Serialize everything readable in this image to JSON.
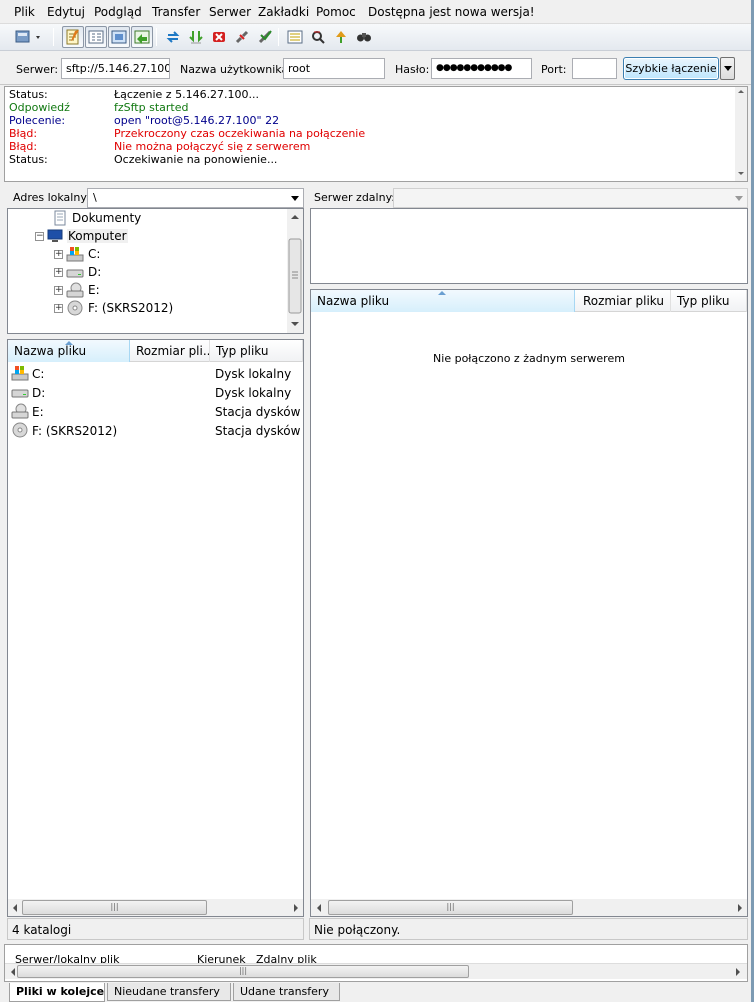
{
  "menu": [
    "Plik",
    "Edytuj",
    "Podgląd",
    "Transfer",
    "Serwer",
    "Zakładki",
    "Pomoc",
    "Dostępna jest nowa wersja!"
  ],
  "toolbar": {
    "buttons": [
      "site-manager-icon",
      "log-toggle-icon",
      "directory-tree-icon",
      "remote-tree-icon",
      "queue-toggle-icon",
      "refresh-icon",
      "process-queue-icon",
      "cancel-icon",
      "disconnect-icon",
      "reconnect-icon",
      "filter-icon",
      "compare-icon",
      "sync-browse-icon",
      "search-icon"
    ]
  },
  "quickconnect": {
    "server_label": "Serwer:",
    "server_value": "sftp://5.146.27.100",
    "user_label": "Nazwa użytkownika:",
    "user_value": "root",
    "password_label": "Hasło:",
    "password_value": "●●●●●●●●●●●",
    "port_label": "Port:",
    "port_value": "",
    "connect_label": "Szybkie łączenie"
  },
  "log": [
    {
      "type": "Status:",
      "msg": "Łączenie z 5.146.27.100...",
      "color": "black"
    },
    {
      "type": "Odpowiedź",
      "msg": "fzSftp started",
      "color": "green"
    },
    {
      "type": "Polecenie:",
      "msg": "open \"root@5.146.27.100\" 22",
      "color": "blue"
    },
    {
      "type": "Błąd:",
      "msg": "Przekroczony czas oczekiwania na połączenie",
      "color": "red"
    },
    {
      "type": "Błąd:",
      "msg": "Nie można połączyć się z serwerem",
      "color": "red"
    },
    {
      "type": "Status:",
      "msg": "Oczekiwanie na ponowienie...",
      "color": "black"
    }
  ],
  "local": {
    "path_label": "Adres lokalny:",
    "path_value": "\\",
    "tree": [
      {
        "label": "Dokumenty",
        "icon": "documents-icon"
      },
      {
        "label": "Komputer",
        "icon": "computer-icon"
      },
      {
        "label": "C:",
        "icon": "drive-c-icon"
      },
      {
        "label": "D:",
        "icon": "drive-d-icon"
      },
      {
        "label": "E:",
        "icon": "drive-e-icon"
      },
      {
        "label": "F: (SKRS2012)",
        "icon": "drive-f-icon"
      }
    ],
    "columns": [
      "Nazwa pliku",
      "Rozmiar pli...",
      "Typ pliku"
    ],
    "files": [
      {
        "name": "C:",
        "size": "",
        "type": "Dysk lokalny"
      },
      {
        "name": "D:",
        "size": "",
        "type": "Dysk lokalny"
      },
      {
        "name": "E:",
        "size": "",
        "type": "Stacja dysków ..."
      },
      {
        "name": "F: (SKRS2012)",
        "size": "",
        "type": "Stacja dysków ..."
      }
    ],
    "status": "4 katalogi"
  },
  "remote": {
    "path_label": "Serwer zdalny:",
    "path_value": "",
    "columns": [
      "Nazwa pliku",
      "Rozmiar pliku",
      "Typ pliku"
    ],
    "empty_message": "Nie połączono z żadnym serwerem",
    "status": "Nie połączony."
  },
  "queue": {
    "columns": [
      "Serwer/lokalny plik",
      "Kierunek",
      "Zdalny plik"
    ],
    "tabs": [
      "Pliki w kolejce",
      "Nieudane transfery",
      "Udane transfery"
    ]
  },
  "colors": {
    "accent": "#3c7fb1",
    "error": "#e00000",
    "response": "#107810",
    "command": "#00008b"
  }
}
